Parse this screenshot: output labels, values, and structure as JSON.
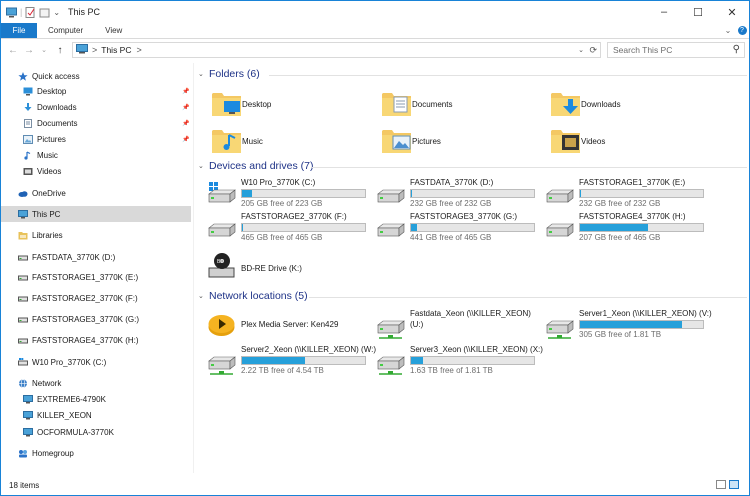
{
  "window": {
    "title": "This PC",
    "min": "–",
    "max": "☐",
    "close": "✕"
  },
  "ribbon": {
    "tabs": [
      "File",
      "Computer",
      "View"
    ]
  },
  "nav": {
    "back": "←",
    "forward": "→",
    "recent": "⌄",
    "up": "↑",
    "breadcrumb": "This PC",
    "breadcrumb_sep": ">",
    "search_placeholder": "Search This PC"
  },
  "sidebar": {
    "items": [
      {
        "label": "Quick access",
        "icon": "star-icon",
        "color": "#2b73c8"
      },
      {
        "label": "Desktop",
        "icon": "desktop-icon",
        "color": "#2b8fd8",
        "pinned": true
      },
      {
        "label": "Downloads",
        "icon": "download-icon",
        "color": "#2b8fd8",
        "pinned": true
      },
      {
        "label": "Documents",
        "icon": "documents-icon",
        "color": "#c9d4de",
        "pinned": true
      },
      {
        "label": "Pictures",
        "icon": "pictures-icon",
        "color": "#6aa8d8",
        "pinned": true
      },
      {
        "label": "Music",
        "icon": "music-icon",
        "color": "#2b73c8"
      },
      {
        "label": "Videos",
        "icon": "videos-icon",
        "color": "#6a6a6a"
      },
      {
        "label": "OneDrive",
        "icon": "cloud-icon",
        "color": "#1f62b5"
      },
      {
        "label": "This PC",
        "icon": "computer-icon",
        "color": "#4aa2d8",
        "selected": true
      },
      {
        "label": "Libraries",
        "icon": "libraries-icon",
        "color": "#e8c25a"
      },
      {
        "label": "FASTDATA_3770K (D:)",
        "icon": "drive-icon",
        "color": "#777"
      },
      {
        "label": "FASTSTORAGE1_3770K (E:)",
        "icon": "drive-icon",
        "color": "#777"
      },
      {
        "label": "FASTSTORAGE2_3770K (F:)",
        "icon": "drive-icon",
        "color": "#777"
      },
      {
        "label": "FASTSTORAGE3_3770K (G:)",
        "icon": "drive-icon",
        "color": "#777"
      },
      {
        "label": "FASTSTORAGE4_3770K (H:)",
        "icon": "drive-icon",
        "color": "#777"
      },
      {
        "label": "W10 Pro_3770K (C:)",
        "icon": "windows-drive-icon",
        "color": "#777"
      },
      {
        "label": "Network",
        "icon": "network-icon",
        "color": "#3a7fc8"
      },
      {
        "label": "EXTREME6-4790K",
        "icon": "computer-icon",
        "color": "#4aa2d8"
      },
      {
        "label": "KILLER_XEON",
        "icon": "computer-icon",
        "color": "#4aa2d8"
      },
      {
        "label": "OCFORMULA-3770K",
        "icon": "computer-icon",
        "color": "#4aa2d8"
      },
      {
        "label": "Homegroup",
        "icon": "homegroup-icon",
        "color": "#2b73c8"
      }
    ]
  },
  "sections": {
    "folders": "Folders (6)",
    "devices": "Devices and drives (7)",
    "network": "Network locations (5)"
  },
  "folders": [
    {
      "label": "Desktop",
      "icon": "desktop-folder-icon"
    },
    {
      "label": "Documents",
      "icon": "documents-folder-icon"
    },
    {
      "label": "Downloads",
      "icon": "downloads-folder-icon"
    },
    {
      "label": "Music",
      "icon": "music-folder-icon"
    },
    {
      "label": "Pictures",
      "icon": "pictures-folder-icon"
    },
    {
      "label": "Videos",
      "icon": "videos-folder-icon"
    }
  ],
  "drives": [
    {
      "name": "W10 Pro_3770K (C:)",
      "free": "205 GB free of 223 GB",
      "used": 0.08,
      "icon": "windows-drive-icon"
    },
    {
      "name": "FASTDATA_3770K (D:)",
      "free": "232 GB free of 232 GB",
      "used": 0.01,
      "icon": "drive-icon"
    },
    {
      "name": "FASTSTORAGE1_3770K (E:)",
      "free": "232 GB free of 232 GB",
      "used": 0.01,
      "icon": "drive-icon"
    },
    {
      "name": "FASTSTORAGE2_3770K (F:)",
      "free": "465 GB free of 465 GB",
      "used": 0.01,
      "icon": "drive-icon"
    },
    {
      "name": "FASTSTORAGE3_3770K (G:)",
      "free": "441 GB free of 465 GB",
      "used": 0.05,
      "icon": "drive-icon"
    },
    {
      "name": "FASTSTORAGE4_3770K (H:)",
      "free": "207 GB free of 465 GB",
      "used": 0.55,
      "icon": "drive-icon"
    },
    {
      "name": "BD-RE Drive (K:)",
      "icon": "bluray-drive-icon"
    }
  ],
  "network_locations": [
    {
      "name": "Plex Media Server: Ken429",
      "icon": "plex-icon"
    },
    {
      "name": "Fastdata_Xeon (\\\\KILLER_XEON)",
      "name2": "(U:)",
      "icon": "network-drive-icon"
    },
    {
      "name": "Server1_Xeon (\\\\KILLER_XEON) (V:)",
      "free": "305 GB free of 1.81 TB",
      "used": 0.83,
      "icon": "network-drive-icon"
    },
    {
      "name": "Server2_Xeon (\\\\KILLER_XEON) (W:)",
      "free": "2.22 TB free of 4.54 TB",
      "used": 0.51,
      "icon": "network-drive-icon"
    },
    {
      "name": "Server3_Xeon (\\\\KILLER_XEON) (X:)",
      "free": "1.63 TB free of 1.81 TB",
      "used": 0.1,
      "icon": "network-drive-icon"
    }
  ],
  "status": {
    "items": "18 items"
  }
}
